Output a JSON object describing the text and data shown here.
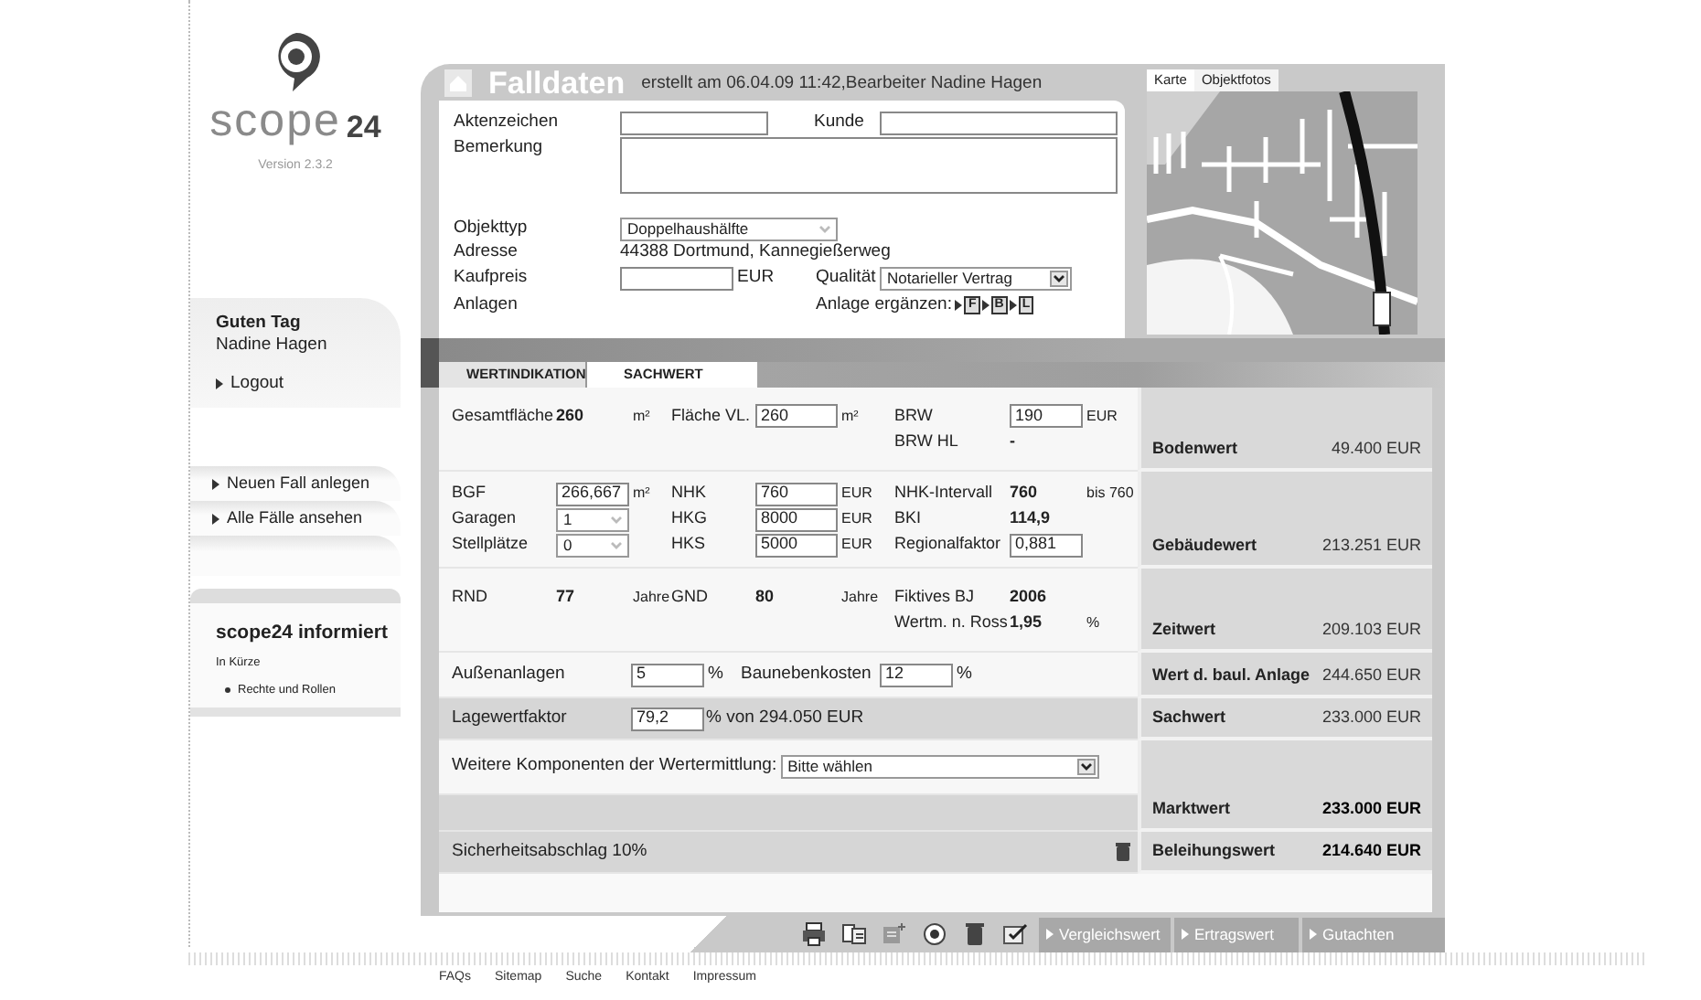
{
  "sidebar": {
    "logo_word": "scope",
    "logo_number": "24",
    "version": "Version 2.3.2",
    "greeting": "Guten Tag",
    "user": "Nadine Hagen",
    "account_links": [
      "Logout"
    ],
    "nav": [
      "Neuen Fall anlegen",
      "Alle Fälle ansehen"
    ],
    "info": {
      "title": "scope24 informiert",
      "subtitle": "In Kürze",
      "items": [
        "Rechte und Rollen"
      ]
    }
  },
  "header": {
    "title": "Falldaten",
    "meta": "erstellt am 06.04.09 11:42,Bearbeiter Nadine Hagen"
  },
  "case_form": {
    "aktenzeichen": {
      "label": "Aktenzeichen"
    },
    "kunde": {
      "label": "Kunde"
    },
    "bemerkung": {
      "label": "Bemerkung"
    },
    "objekttyp": {
      "label": "Objekttyp",
      "value": "Doppelhaushälfte",
      "disabled": true
    },
    "adresse": {
      "label": "Adresse",
      "value": "44388 Dortmund, Kannegießerweg"
    },
    "kaufpreis": {
      "label": "Kaufpreis",
      "unit": "EUR"
    },
    "qualitaet": {
      "label": "Qualität",
      "value": "Notarieller Vertrag",
      "disabled": false
    },
    "anlagen": {
      "label": "Anlagen",
      "add_label": "Anlage ergänzen:",
      "add_buttons": [
        "F",
        "B",
        "L"
      ]
    }
  },
  "map": {
    "tabs": [
      {
        "label": "Karte",
        "selected": true
      },
      {
        "label": "Objektfotos",
        "selected": false
      }
    ]
  },
  "tabs": [
    {
      "label": "WERTINDIKATION",
      "selected": false
    },
    {
      "label": "SACHWERT",
      "selected": true
    }
  ],
  "bands": [
    {
      "kind": "fields",
      "rows": [
        [
          {
            "label": "Gesamtfläche",
            "field": {
              "kind": "value",
              "text": "260"
            },
            "unit": "m²"
          },
          {
            "label": "Fläche VL.",
            "field": {
              "kind": "input",
              "text": "260"
            },
            "unit": "m²"
          },
          {
            "label": "BRW",
            "field": {
              "kind": "input",
              "text": "190"
            },
            "unit": "EUR"
          }
        ],
        [
          null,
          null,
          {
            "label": "BRW HL",
            "field": {
              "kind": "value",
              "text": "-"
            }
          }
        ]
      ],
      "result": {
        "label": "Bodenwert",
        "value": "49.400 EUR",
        "emphasis": false
      }
    },
    {
      "kind": "fields",
      "rows": [
        [
          {
            "label": "BGF",
            "field": {
              "kind": "input",
              "text": "266,667"
            },
            "unit": "m²"
          },
          {
            "label": "NHK",
            "field": {
              "kind": "input",
              "text": "760"
            },
            "unit": "EUR"
          },
          {
            "label": "NHK-Intervall",
            "field": {
              "kind": "value",
              "text": "760"
            },
            "unit": "bis 760"
          }
        ],
        [
          {
            "label": "Garagen",
            "field": {
              "kind": "select",
              "text": "1",
              "disabled": true
            }
          },
          {
            "label": "HKG",
            "field": {
              "kind": "input",
              "text": "8000"
            },
            "unit": "EUR"
          },
          {
            "label": "BKI",
            "field": {
              "kind": "value",
              "text": "114,9"
            }
          }
        ],
        [
          {
            "label": "Stellplätze",
            "field": {
              "kind": "select",
              "text": "0",
              "disabled": true
            }
          },
          {
            "label": "HKS",
            "field": {
              "kind": "input",
              "text": "5000"
            },
            "unit": "EUR"
          },
          {
            "label": "Regionalfaktor",
            "field": {
              "kind": "input",
              "text": "0,881"
            }
          }
        ]
      ],
      "result": {
        "label": "Gebäudewert",
        "value": "213.251 EUR",
        "emphasis": false
      }
    },
    {
      "kind": "fields",
      "rows": [
        [
          {
            "label": "RND",
            "field": {
              "kind": "value",
              "text": "77"
            },
            "unit": "Jahre"
          },
          {
            "label": "GND",
            "field": {
              "kind": "value",
              "text": "80"
            },
            "unit": "Jahre"
          },
          {
            "label": "Fiktives BJ",
            "field": {
              "kind": "value",
              "text": "2006"
            }
          }
        ],
        [
          null,
          null,
          {
            "label": "Wertm. n. Ross",
            "field": {
              "kind": "value",
              "text": "1,95"
            },
            "unit": "%"
          }
        ]
      ],
      "result": {
        "label": "Zeitwert",
        "value": "209.103 EUR",
        "emphasis": false
      }
    },
    {
      "kind": "pair",
      "rows": [
        [
          {
            "label": "Außenanlagen",
            "field": {
              "kind": "input",
              "text": "5"
            },
            "unit": "%"
          },
          {
            "label": "Baunebenkosten",
            "field": {
              "kind": "input",
              "text": "12"
            },
            "unit": "%"
          }
        ]
      ],
      "result": {
        "label": "Wert d. baul. Anlage",
        "value": "244.650 EUR",
        "emphasis": false
      }
    },
    {
      "kind": "factor",
      "rows": [
        [
          {
            "label": "Lagewertfaktor",
            "field": {
              "kind": "input",
              "text": "79,2"
            },
            "unit": "% von 294.050 EUR"
          }
        ]
      ],
      "result": {
        "label": "Sachwert",
        "value": "233.000 EUR",
        "emphasis": false
      }
    },
    {
      "kind": "select",
      "rows": [
        [
          {
            "label": "Weitere Komponenten der Wertermittlung:",
            "field": {
              "kind": "select",
              "text": "Bitte wählen",
              "disabled": false
            }
          }
        ]
      ]
    },
    {
      "kind": "blank",
      "result": {
        "label": "Marktwert",
        "value": "233.000 EUR",
        "emphasis": true
      }
    },
    {
      "kind": "note",
      "rows": [
        [
          {
            "label": "Sicherheitsabschlag 10%"
          }
        ]
      ],
      "result": {
        "label": "Beleihungswert",
        "value": "214.640 EUR",
        "emphasis": true
      }
    }
  ],
  "toolbar": {
    "buttons": [
      "Vergleichswert",
      "Ertragswert",
      "Gutachten"
    ]
  },
  "footer": [
    "FAQs",
    "Sitemap",
    "Suche",
    "Kontakt",
    "Impressum"
  ]
}
